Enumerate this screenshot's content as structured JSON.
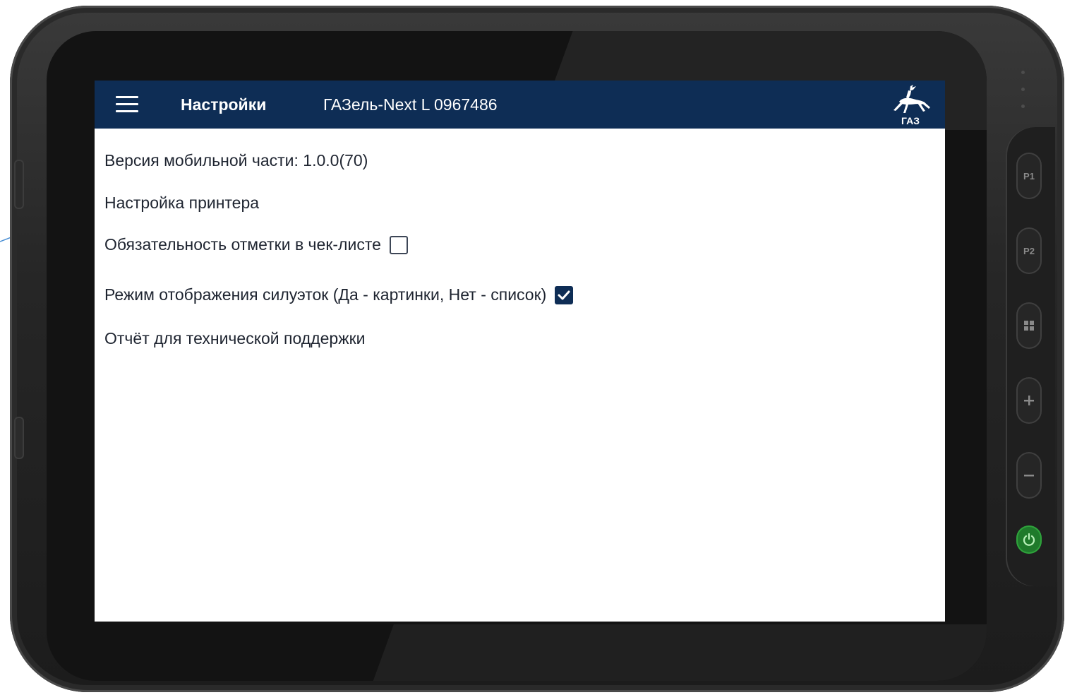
{
  "app_bar": {
    "title": "Настройки",
    "vehicle": "ГАЗель-Next L 0967486",
    "logo_text": "ГАЗ",
    "menu_icon": "hamburger-menu-icon"
  },
  "settings": {
    "version_text": "Версия мобильной части: 1.0.0(70)",
    "printer_label": "Настройка принтера",
    "checklist_required_label": "Обязательность отметки в чек-листе",
    "checklist_required_checked": false,
    "silhouette_mode_label": "Режим отображения силуэток (Да - картинки, Нет - список)",
    "silhouette_mode_checked": true,
    "support_report_label": "Отчёт для технической поддержки"
  },
  "device": {
    "hw_buttons": [
      "P1",
      "P2",
      "windows-icon",
      "plus-icon",
      "minus-icon",
      "power-icon"
    ],
    "p1_label": "P1",
    "p2_label": "P2"
  },
  "colors": {
    "app_bar": "#0e2d55",
    "text": "#1e2430",
    "checkbox_checked": "#0e2d55",
    "annotation_arrow": "#4a8fd4",
    "power_button": "#1f7a2b"
  }
}
